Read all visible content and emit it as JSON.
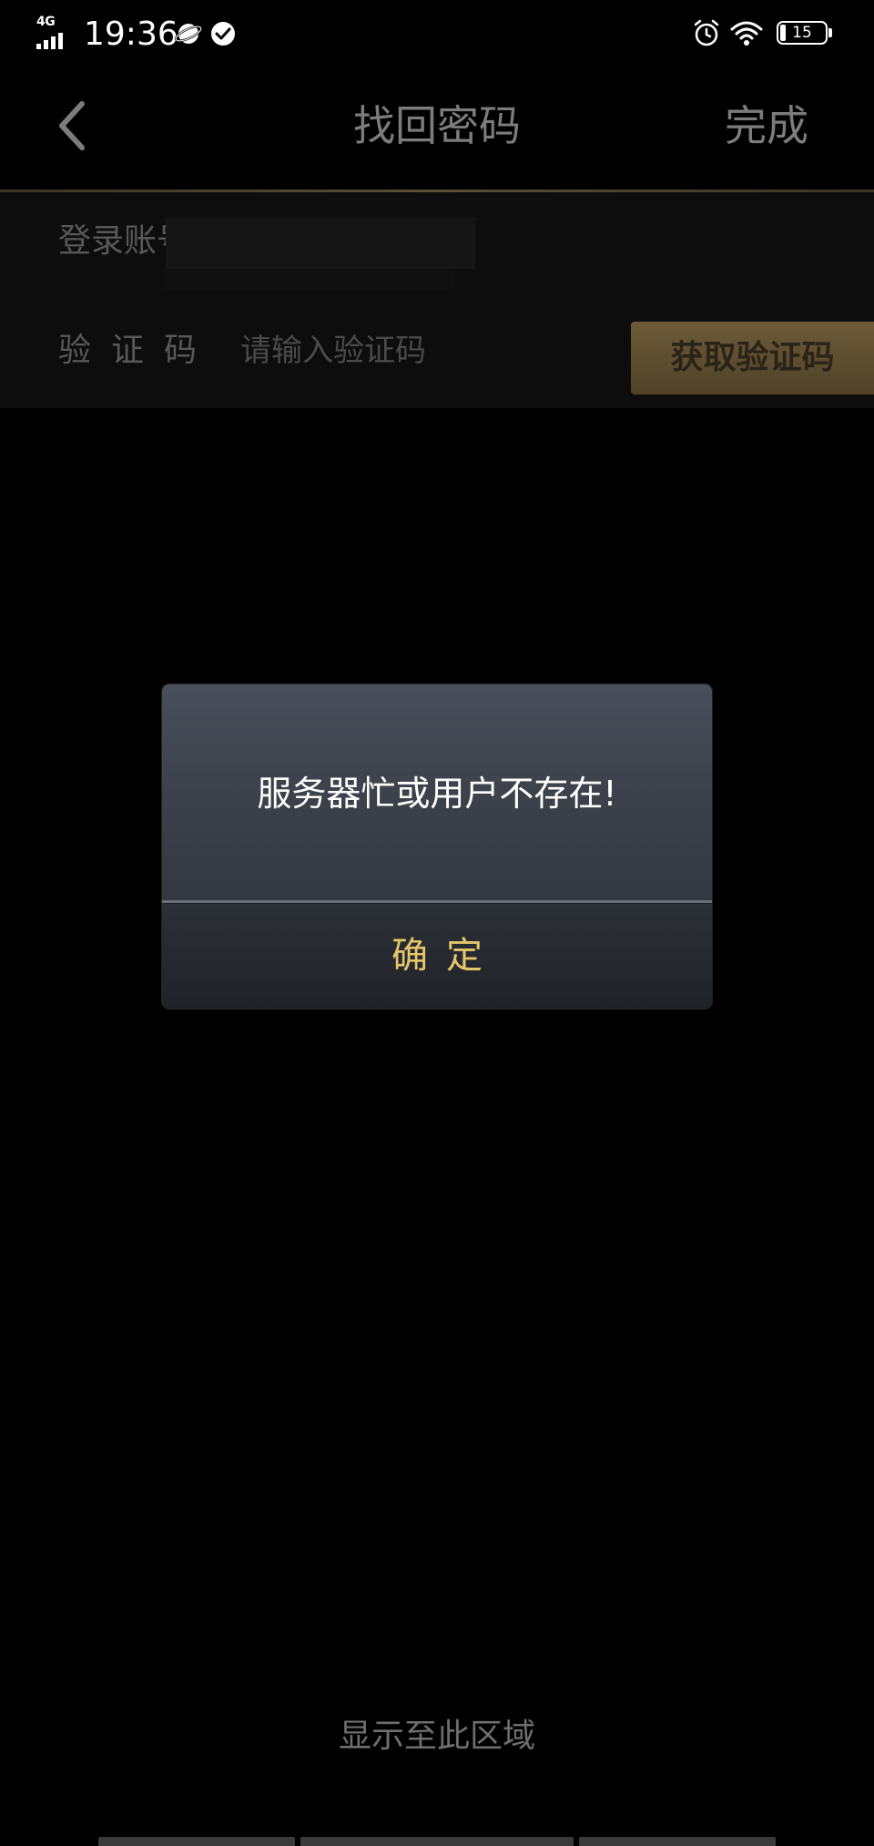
{
  "status_bar": {
    "network": "4G",
    "time": "19:36",
    "battery": "15",
    "icons": [
      "signal-icon",
      "planet-icon",
      "check-circle-icon",
      "alarm-icon",
      "wifi-icon",
      "battery-icon"
    ]
  },
  "nav": {
    "back_icon": "chevron-left-icon",
    "title": "找回密码",
    "done_label": "完成"
  },
  "form": {
    "account_label": "登录账号",
    "code_label": "验证码",
    "code_placeholder": "请输入验证码",
    "code_value": "",
    "get_code_label": "获取验证码"
  },
  "dialog": {
    "message": "服务器忙或用户不存在!",
    "confirm_label": "确定"
  },
  "bottom": {
    "hint": "显示至此区域"
  },
  "colors": {
    "background": "#000000",
    "accent_gold": "#e6c66a",
    "button_gold": "#6d5b38",
    "dialog_top": "#484e5a",
    "dialog_bottom": "#202328",
    "muted_text": "#7c7c7c"
  }
}
